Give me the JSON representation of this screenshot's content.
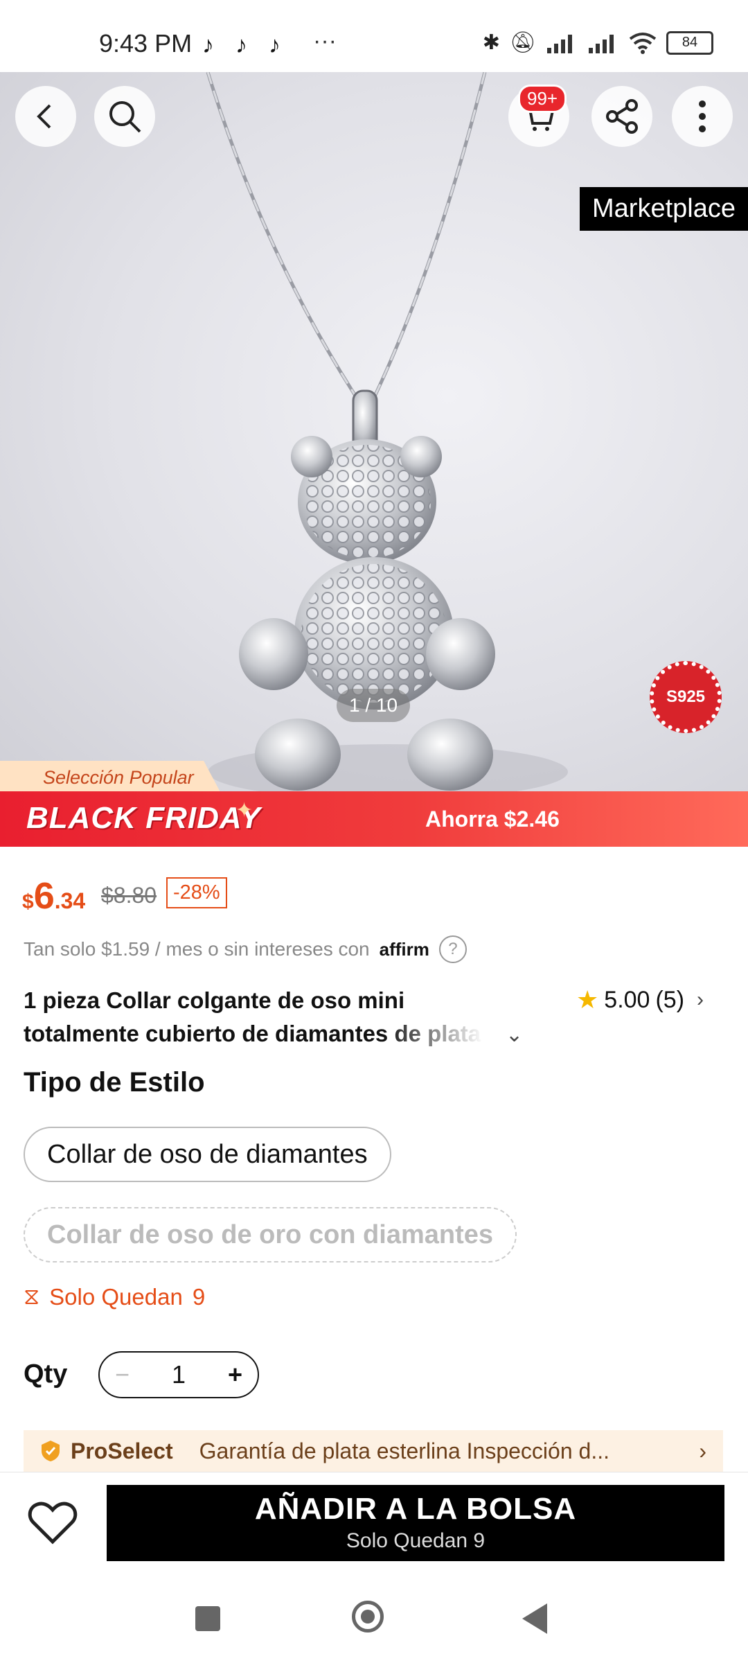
{
  "status_bar": {
    "time": "9:43 PM",
    "apps": [
      "tiktok-icon",
      "tiktok-icon",
      "tiktok-icon"
    ],
    "more": "···",
    "battery": "84"
  },
  "hero": {
    "cart_badge": "99+",
    "marketplace_label": "Marketplace",
    "image_counter": "1 / 10",
    "seal_text": "S925"
  },
  "banner": {
    "popular_label": "Selección Popular",
    "event_title": "BLACK FRIDAY",
    "savings": "Ahorra $2.46"
  },
  "price": {
    "currency": "$",
    "integer": "6",
    "decimal": ".34",
    "original": "$8.80",
    "discount": "-28%"
  },
  "financing": {
    "text": "Tan solo $1.59 / mes o sin intereses con",
    "provider": "affirm",
    "help": "?"
  },
  "product": {
    "title_line1": "1 pieza Collar colgante de oso mini",
    "title_line2": "totalmente cubierto de diamantes de plata",
    "rating": "5.00",
    "reviews": "(5)"
  },
  "style": {
    "heading": "Tipo de Estilo",
    "options": [
      {
        "label": "Collar de oso de diamantes",
        "available": true
      },
      {
        "label": "Collar de oso de oro con diamantes",
        "available": false
      }
    ]
  },
  "stock": {
    "label": "Solo Quedan",
    "count": "9"
  },
  "quantity": {
    "label": "Qty",
    "value": "1",
    "minus": "−",
    "plus": "+"
  },
  "proselect": {
    "name": "ProSelect",
    "description": "Garantía de plata esterlina Inspección d..."
  },
  "cta": {
    "main": "AÑADIR A LA BOLSA",
    "sub": "Solo Quedan  9"
  },
  "colors": {
    "accent": "#e54d17",
    "banner_red": "#e91f2f",
    "cta_bg": "#000000",
    "star": "#f5b800"
  }
}
